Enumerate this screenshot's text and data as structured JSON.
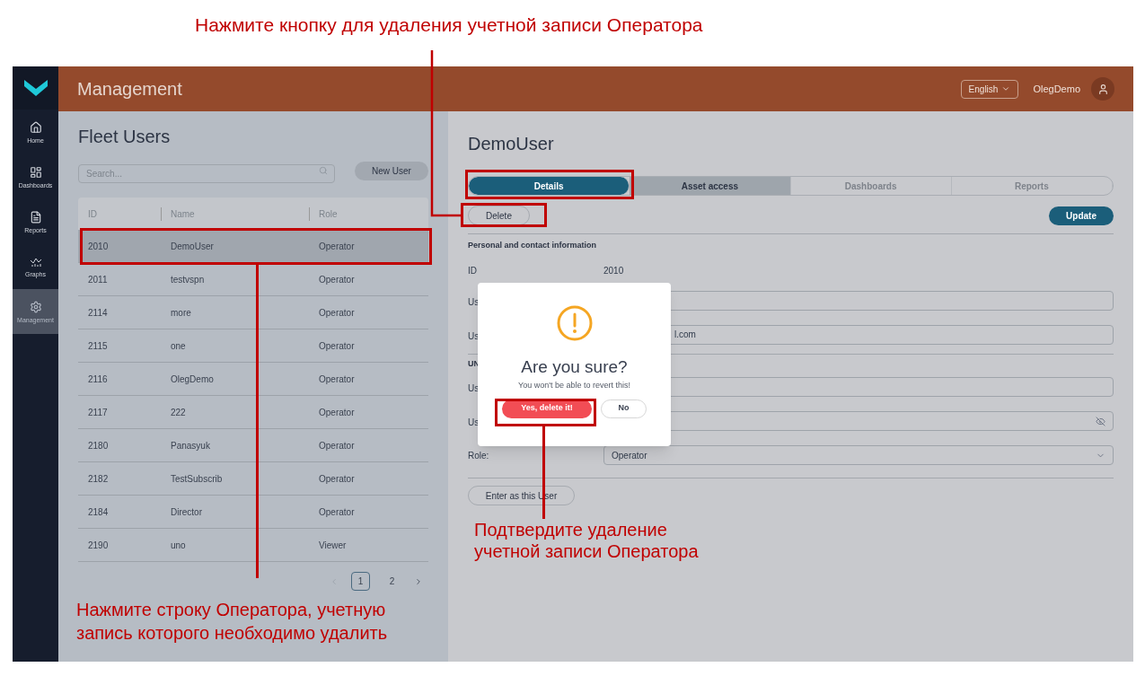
{
  "annotations": [
    {
      "text": "Нажмите кнопку для удаления учетной записи Оператора"
    },
    {
      "text": "Нажмите строку Оператора, учетную запись которого необходимо удалить"
    },
    {
      "text": "Подтвердите удаление учетной записи Оператора"
    }
  ],
  "sidebar": {
    "items": [
      {
        "label": "Home",
        "selected": false
      },
      {
        "label": "Dashboards",
        "selected": false
      },
      {
        "label": "Reports",
        "selected": false
      },
      {
        "label": "Graphs",
        "selected": false
      },
      {
        "label": "Management",
        "selected": true
      }
    ]
  },
  "header": {
    "title": "Management",
    "language": "English",
    "user": "OlegDemo"
  },
  "fleet_users": {
    "title": "Fleet Users",
    "search": {
      "placeholder": "Search..."
    },
    "new_button": "New User",
    "columns": [
      "ID",
      "Name",
      "Role"
    ],
    "rows": [
      {
        "id": "2010",
        "name": "DemoUser",
        "role": "Operator",
        "selected": true
      },
      {
        "id": "2011",
        "name": "testvspn",
        "role": "Operator",
        "selected": false
      },
      {
        "id": "2114",
        "name": "more",
        "role": "Operator",
        "selected": false
      },
      {
        "id": "2115",
        "name": "one",
        "role": "Operator",
        "selected": false
      },
      {
        "id": "2116",
        "name": "OlegDemo",
        "role": "Operator",
        "selected": false
      },
      {
        "id": "2117",
        "name": "222",
        "role": "Operator",
        "selected": false
      },
      {
        "id": "2180",
        "name": "Panasyuk",
        "role": "Operator",
        "selected": false
      },
      {
        "id": "2182",
        "name": "TestSubscrib",
        "role": "Operator",
        "selected": false
      },
      {
        "id": "2184",
        "name": "Director",
        "role": "Operator",
        "selected": false
      },
      {
        "id": "2190",
        "name": "uno",
        "role": "Viewer",
        "selected": false
      }
    ],
    "pages": [
      {
        "label": "1",
        "selected": true
      },
      {
        "label": "2",
        "selected": false
      }
    ]
  },
  "details": {
    "title": "DemoUser",
    "tabs": [
      {
        "label": "Details",
        "selected": true,
        "disabled": false
      },
      {
        "label": "Asset access",
        "selected": false,
        "disabled": false
      },
      {
        "label": "Dashboards",
        "selected": false,
        "disabled": true
      },
      {
        "label": "Reports",
        "selected": false,
        "disabled": true
      }
    ],
    "delete_button": "Delete",
    "update_button": "Update",
    "section_1": "Personal and contact information",
    "id_label": "ID",
    "id_value": "2010",
    "fields_1": [
      {
        "label": "Us",
        "kind": "text"
      },
      {
        "label": "Us",
        "kind": "text",
        "value": "l.com"
      }
    ],
    "section_2": "UN",
    "fields_2": [
      {
        "label": "Us",
        "kind": "text"
      },
      {
        "label": "Us",
        "kind": "password"
      }
    ],
    "role_label": "Role:",
    "role_value": "Operator",
    "enter_button": "Enter as this User"
  },
  "dialog": {
    "title": "Are you sure?",
    "message": "You won't be able to revert this!",
    "confirm_button": "Yes, delete it!",
    "cancel_button": "No"
  }
}
